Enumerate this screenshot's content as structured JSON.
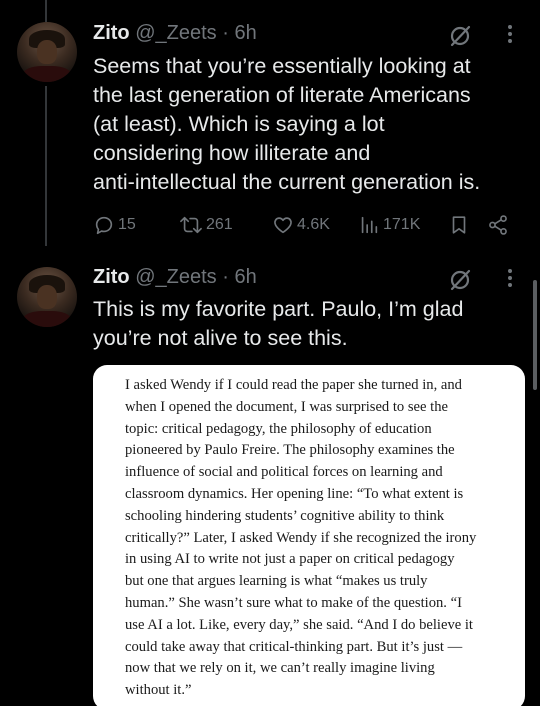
{
  "tweets": [
    {
      "name": "Zito",
      "handle": "@_Zeets",
      "separator": "·",
      "time": "6h",
      "text_lines": [
        "Seems that you’re essentially looking at",
        "the last generation of literate Americans",
        "(at least). Which is saying a lot",
        "considering how illiterate and",
        "anti-intellectual the current generation is."
      ],
      "actions": {
        "replies": "15",
        "reposts": "261",
        "likes": "4.6K",
        "views": "171K"
      }
    },
    {
      "name": "Zito",
      "handle": "@_Zeets",
      "separator": "·",
      "time": "6h",
      "text_lines": [
        "This is my favorite part. Paulo, I’m glad",
        "you’re not alive to see this."
      ]
    }
  ],
  "quote_image": {
    "lines": [
      "I asked Wendy if I could read the paper she turned in, and",
      "when I opened the document, I was surprised to see the",
      "topic: critical pedagogy, the philosophy of education",
      "pioneered by Paulo Freire. The philosophy examines the",
      "influence of social and political forces on learning and",
      "classroom dynamics. Her opening line: “To what extent is",
      "schooling hindering students’ cognitive ability to think",
      "critically?” Later, I asked Wendy if she recognized the irony",
      "in using AI to write not just a paper on critical pedagogy",
      "but one that argues learning is what “makes us truly",
      "human.” She wasn’t sure what to make of the question. “I",
      "use AI a lot. Like, every day,” she said. “And I do believe it",
      "could take away that critical-thinking part. But it’s just —",
      "now that we rely on it, we can’t really imagine living",
      "without it.”"
    ]
  },
  "icons": {
    "grok": "grok-slash-icon",
    "more": "more-vertical-icon",
    "reply": "reply-bubble-icon",
    "repost": "repost-arrows-icon",
    "like": "heart-icon",
    "views": "views-bar-icon",
    "bookmark": "bookmark-icon",
    "share": "share-icon"
  },
  "colors": {
    "background": "#000000",
    "primary_text": "#e7e9ea",
    "secondary_text": "#71767b",
    "quote_background": "#ffffff"
  }
}
